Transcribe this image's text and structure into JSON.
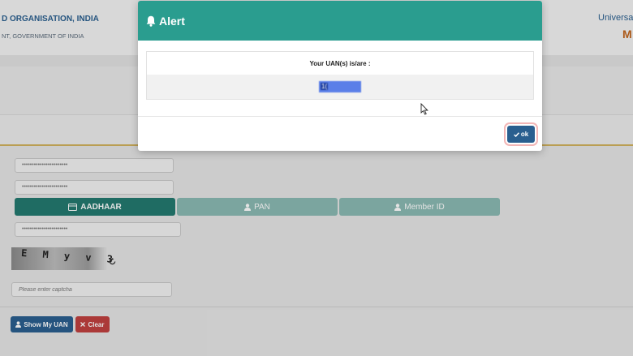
{
  "header": {
    "org_title": "D ORGANISATION, INDIA",
    "org_subtitle": "NT, GOVERNMENT OF INDIA",
    "right_title": "Universa",
    "right_sub": "M"
  },
  "form": {
    "field1_value": "•••••••••••••••••••••••",
    "field2_value": "•••••••••••••••••••••••",
    "tabs": [
      {
        "label": "AADHAAR",
        "icon": "id-card-icon",
        "active": true
      },
      {
        "label": "PAN",
        "icon": "user-icon",
        "active": false
      },
      {
        "label": "Member ID",
        "icon": "user-icon",
        "active": false
      }
    ],
    "id_field_value": "•••••••••••••••••••••••",
    "captcha_text": "E M y  v 3",
    "captcha_placeholder": "Please enter captcha",
    "show_uan_label": "Show My UAN",
    "clear_label": "Clear"
  },
  "modal": {
    "title": "Alert",
    "heading": "Your UAN(s) is/are :",
    "uan_visible": "1(",
    "ok_label": "ok"
  },
  "colors": {
    "modal_header": "#2a9d8f",
    "primary_button": "#2a5f8f",
    "danger_button": "#c0403f",
    "active_tab": "#237a70",
    "inactive_tab": "#8bbab3"
  }
}
